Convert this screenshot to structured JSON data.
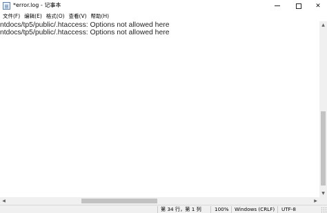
{
  "window": {
    "title": "*error.log - 记事本",
    "icon": "notepad-icon"
  },
  "menu": {
    "items": [
      "文件(F)",
      "编辑(E)",
      "格式(O)",
      "查看(V)",
      "帮助(H)"
    ]
  },
  "editor": {
    "lines": [
      "ntdocs/tp5/public/.htaccess: Options not allowed here",
      "ntdocs/tp5/public/.htaccess: Options not allowed here"
    ]
  },
  "status": {
    "position": "第 34 行，第 1 列",
    "zoom": "100%",
    "line_ending": "Windows (CRLF)",
    "encoding": "UTF-8"
  }
}
